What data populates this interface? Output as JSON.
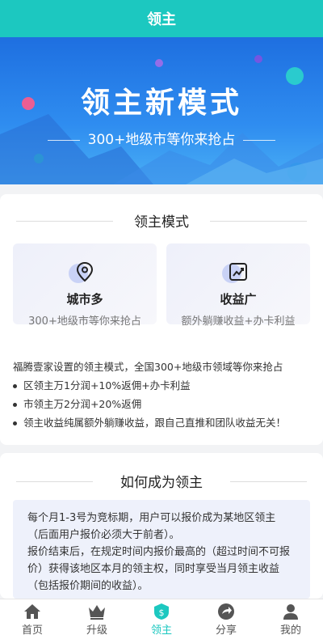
{
  "header": {
    "title": "领主"
  },
  "banner": {
    "headline": "领主新模式",
    "subline": "300+地级市等你来抢占"
  },
  "mode_section": {
    "title": "领主模式",
    "features": [
      {
        "icon": "location-pin-icon",
        "title": "城市多",
        "desc": "300+地级市等你来抢占"
      },
      {
        "icon": "trend-chart-icon",
        "title": "收益广",
        "desc": "额外躺赚收益+办卡利益"
      }
    ],
    "intro": "福腾壹家设置的领主模式，全国300+地级市领域等你来抢占",
    "bullets": [
      "区领主万1分润+10%返佣+办卡利益",
      "市领主万2分润+20%返佣",
      "领主收益纯属额外躺赚收益，跟自己直推和团队收益无关！"
    ]
  },
  "how_section": {
    "title": "如何成为领主",
    "paragraphs": [
      "每个月1-3号为竞标期，用户可以报价成为某地区领主（后面用户报价必须大于前者）。",
      "报价结束后，在规定时间内报价最高的（超过时间不可报价）获得该地区本月的领主权，同时享受当月领主收益（包括报价期间的收益）。"
    ]
  },
  "tabbar": {
    "items": [
      {
        "label": "首页",
        "icon": "home-icon",
        "active": false
      },
      {
        "label": "升级",
        "icon": "crown-icon",
        "active": false
      },
      {
        "label": "领主",
        "icon": "lord-badge-icon",
        "active": true
      },
      {
        "label": "分享",
        "icon": "share-icon",
        "active": false
      },
      {
        "label": "我的",
        "icon": "user-icon",
        "active": false
      }
    ]
  },
  "colors": {
    "accent": "#1cc8c0",
    "banner_top": "#1e6fe0",
    "banner_bottom": "#4ab0f5",
    "feature_bg": "#eef0fa",
    "howbox_bg": "#eef1fb"
  }
}
